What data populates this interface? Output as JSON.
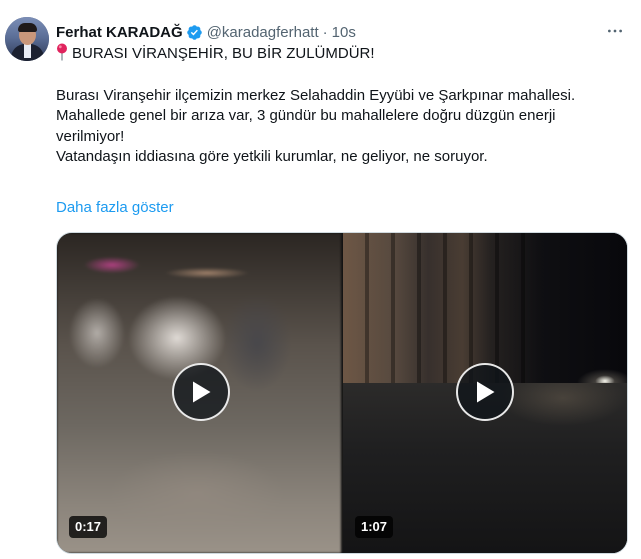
{
  "tweet": {
    "author_name": "Ferhat KARADAĞ",
    "handle": "@karadagferhatt",
    "separator": "·",
    "time": "10s",
    "headline": "BURASI VİRANŞEHİR, BU BİR ZULÜMDÜR!",
    "paragraph_1": "Burası Viranşehir ilçemizin merkez  Selahaddin Eyyübi ve Şarkpınar mahallesi.",
    "paragraph_2": "Mahallede genel bir arıza var, 3 gündür bu mahallelere doğru düzgün enerji verilmiyor!",
    "paragraph_3": "Vatandaşın iddiasına göre yetkili kurumlar, ne geliyor, ne soruyor.",
    "show_more": "Daha fazla göster"
  },
  "media": {
    "videos": [
      {
        "duration": "0:17"
      },
      {
        "duration": "1:07"
      }
    ]
  },
  "icons": {
    "verified": "verified-badge-icon",
    "more": "more-options-icon",
    "pin": "round-pushpin-icon",
    "play": "play-icon"
  },
  "colors": {
    "link": "#1d9bf0",
    "secondary_text": "#536471",
    "verified": "#1d9bf0",
    "pin": "#e0245e"
  }
}
